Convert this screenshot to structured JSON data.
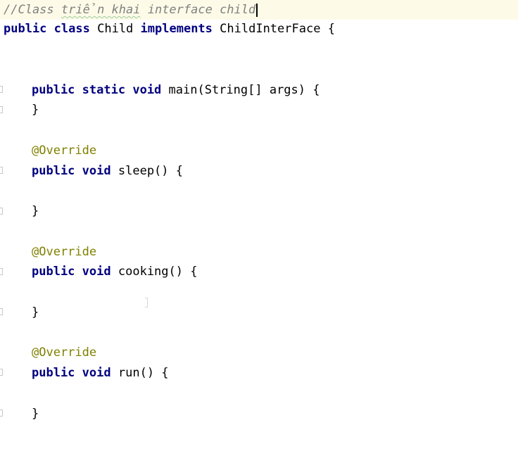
{
  "editor": {
    "comment_prefix": "//Class ",
    "comment_typo": "triển khai",
    "comment_suffix": " interface child",
    "class_decl": {
      "kw1": "public",
      "kw2": "class",
      "name": "Child",
      "kw3": "implements",
      "iface": "ChildInterFace",
      "brace": "{"
    },
    "main": {
      "kw1": "public",
      "kw2": "static",
      "kw3": "void",
      "sig": "main(String[] args) {",
      "close": "}"
    },
    "methods": [
      {
        "annotation": "@Override",
        "kw1": "public",
        "kw2": "void",
        "sig": "sleep() {",
        "close": "}"
      },
      {
        "annotation": "@Override",
        "kw1": "public",
        "kw2": "void",
        "sig": "cooking() {",
        "close": "}"
      },
      {
        "annotation": "@Override",
        "kw1": "public",
        "kw2": "void",
        "sig": "run() {",
        "close": "}"
      }
    ]
  }
}
